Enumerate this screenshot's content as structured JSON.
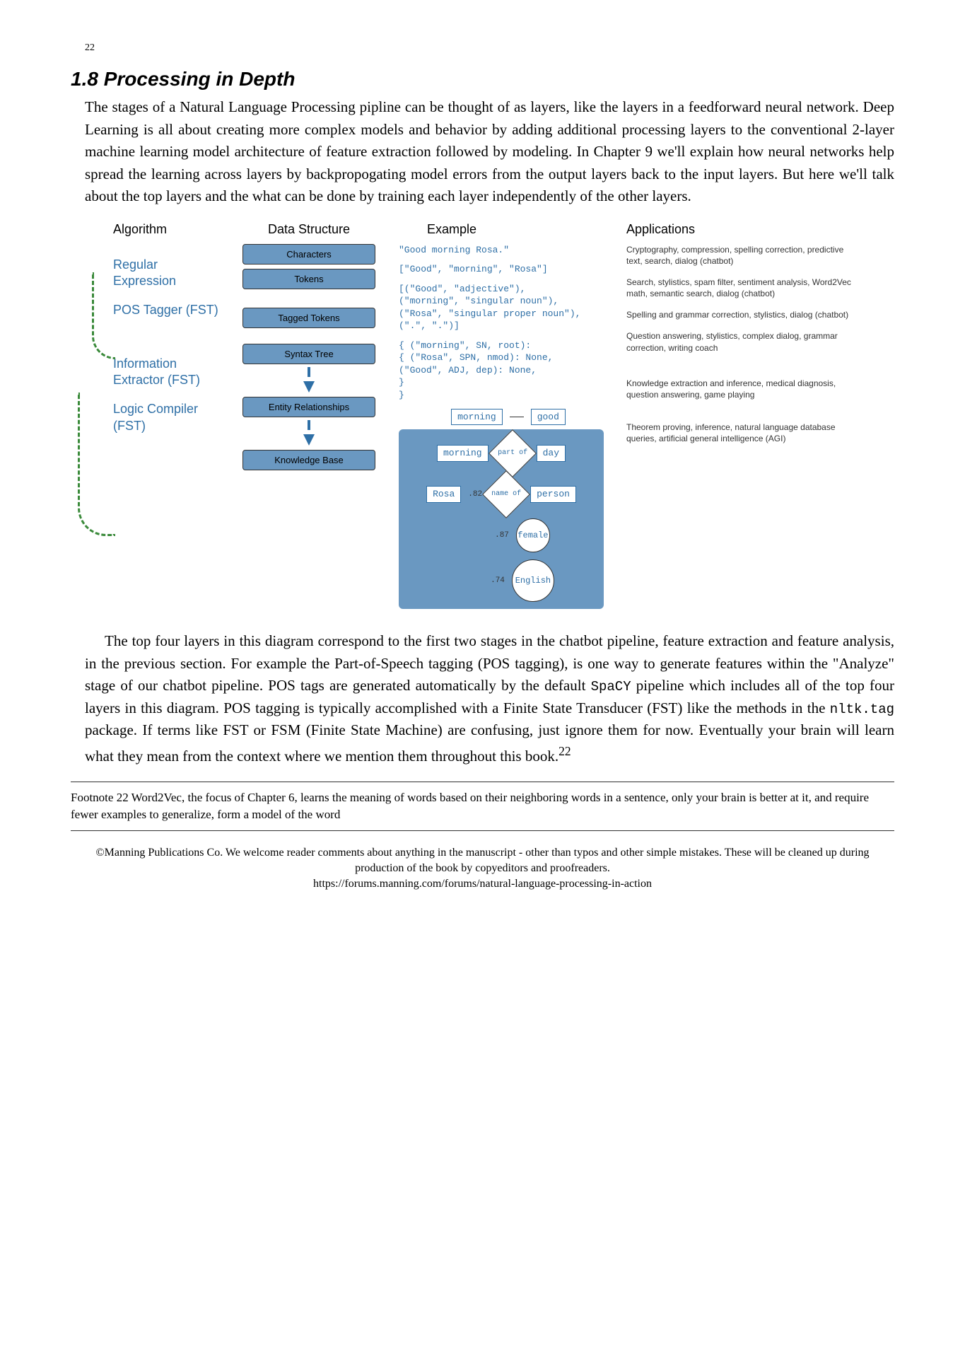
{
  "page_number": "22",
  "section_number": "1.8",
  "section_title": "Processing in Depth",
  "para1": "The stages of a Natural Language Processing pipline can be thought of as layers, like the layers in a feedforward neural network. Deep Learning is all about creating more complex models and behavior by adding additional processing layers to the conventional 2-layer machine learning model architecture of feature extraction followed by modeling. In Chapter 9 we'll explain how neural networks help spread the learning across layers by backpropogating model errors from the output layers back to the input layers. But here we'll talk about the top layers and the what can be done by training each layer independently of the other layers.",
  "diagram": {
    "columns": [
      "Algorithm",
      "Data Structure",
      "Example",
      "Applications"
    ],
    "algorithms": [
      "Regular Expression",
      "POS Tagger (FST)",
      "Information Extractor (FST)",
      "Logic Compiler (FST)"
    ],
    "data_structures": [
      "Characters",
      "Tokens",
      "Tagged Tokens",
      "Syntax Tree",
      "Entity Relationships",
      "Knowledge Base"
    ],
    "examples": {
      "characters": "\"Good morning Rosa.\"",
      "tokens": "[\"Good\", \"morning\", \"Rosa\"]",
      "tagged_l1": "[(\"Good\", \"adjective\"),",
      "tagged_l2": " (\"morning\", \"singular noun\"),",
      "tagged_l3": " (\"Rosa\", \"singular proper noun\"),",
      "tagged_l4": " (\".\", \".\")]",
      "syntax_l1": "{ (\"morning\", SN, root):",
      "syntax_l2": "  { (\"Rosa\", SPN, nmod): None,",
      "syntax_l3": "    (\"Good\", ADJ, dep): None,",
      "syntax_l4": "  }",
      "syntax_l5": "}",
      "entity_a": "morning",
      "entity_b": "good",
      "kb": {
        "row1_a": "morning",
        "row1_rel": "part of",
        "row1_b": "day",
        "row2_a": "Rosa",
        "row2_w": ".82",
        "row2_rel": "name of",
        "row2_b": "person",
        "row3_w": ".87",
        "row3_b": "female",
        "row4_w": ".74",
        "row4_b": "English"
      }
    },
    "applications": [
      "Cryptography, compression, spelling correction, predictive text, search, dialog (chatbot)",
      "Search, stylistics, spam filter, sentiment analysis, Word2Vec math, semantic search, dialog (chatbot)",
      "Spelling and grammar correction, stylistics, dialog (chatbot)",
      "Question answering, stylistics, complex dialog, grammar correction, writing coach",
      "Knowledge extraction and inference, medical diagnosis, question answering, game playing",
      "Theorem proving, inference, natural language database queries, artificial general intelligence (AGI)"
    ]
  },
  "para2_a": "The top four layers in this diagram correspond to the first two stages in the chatbot pipeline, feature extraction and feature analysis, in the previous section. For example the Part-of-Speech tagging (POS tagging), is one way to generate features within the \"Analyze\" stage of our chatbot pipeline. POS tags are generated automatically by the default ",
  "para2_code1": "SpaCY",
  "para2_b": " pipeline which includes all of the top four layers in this diagram. POS tagging is typically accomplished with a Finite State Transducer (FST) like the methods in the ",
  "para2_code2": "nltk.tag",
  "para2_c": " package. If terms like FST or FSM (Finite State Machine) are confusing, just ignore them for now. Eventually your brain will learn what they mean from the context where we mention them throughout this book.",
  "footnote_ref": "22",
  "footnote": "Footnote 22   Word2Vec, the focus of Chapter 6, learns the meaning of words based on their neighboring words in a sentence, only your brain is better at it, and require fewer examples to generalize, form a model of the word",
  "bottom1": "©Manning Publications Co. We welcome reader comments about anything in the manuscript - other than typos and other simple mistakes. These will be cleaned up during production of the book by copyeditors and proofreaders.",
  "bottom2": "https://forums.manning.com/forums/natural-language-processing-in-action"
}
